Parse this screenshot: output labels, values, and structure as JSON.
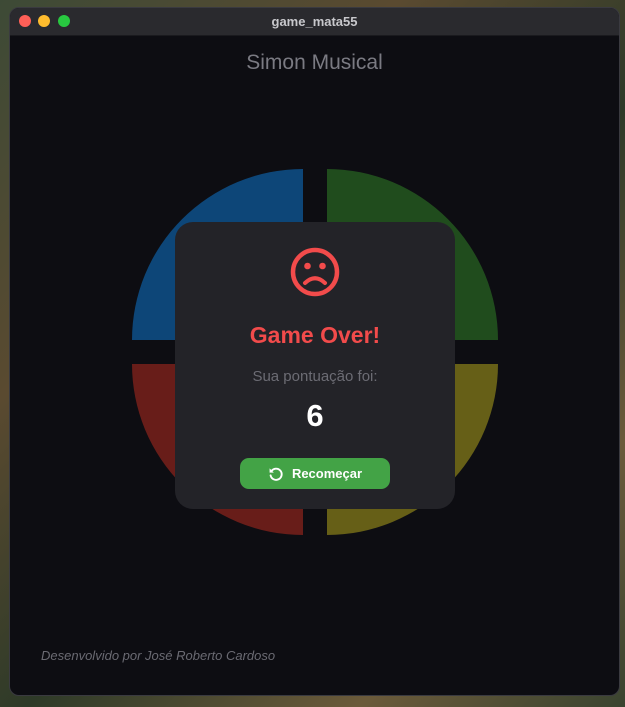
{
  "window": {
    "title": "game_mata55"
  },
  "app": {
    "title": "Simon Musical"
  },
  "board": {
    "quadrants": [
      {
        "name": "blue",
        "color": "#0e4a7e"
      },
      {
        "name": "green",
        "color": "#22501f"
      },
      {
        "name": "red",
        "color": "#6e1f1a"
      },
      {
        "name": "yellow",
        "color": "#6b6418"
      }
    ]
  },
  "dialog": {
    "icon": "sad-face-icon",
    "title": "Game Over!",
    "score_label": "Sua pontuação foi:",
    "score": "6",
    "restart_icon": "refresh-icon",
    "restart_label": "Recomeçar",
    "accent_color": "#f24b4b",
    "button_color": "#43a346"
  },
  "footer": {
    "credit": "Desenvolvido por José Roberto Cardoso"
  }
}
